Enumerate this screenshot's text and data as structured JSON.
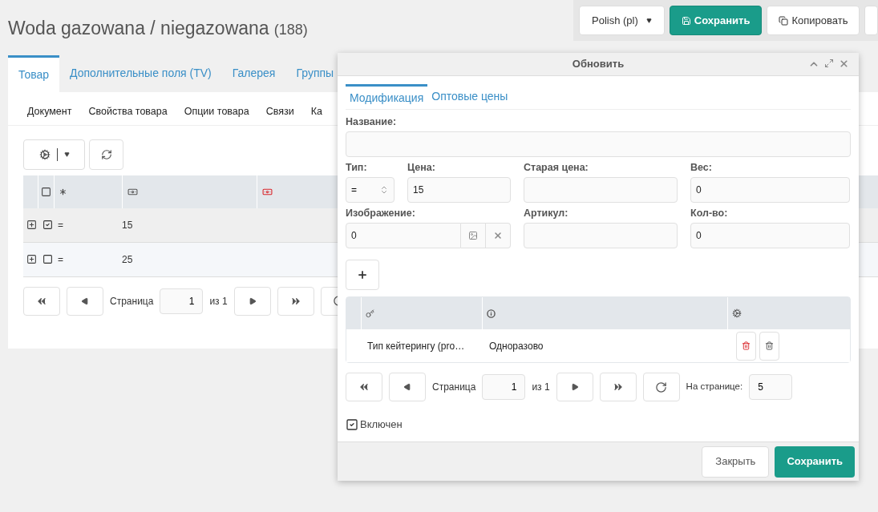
{
  "page": {
    "title": "Woda gazowana / niegazowana",
    "count": "(188)"
  },
  "toolbar": {
    "language": "Polish (pl)",
    "save": "Сохранить",
    "copy": "Копировать"
  },
  "tabs": [
    {
      "label": "Товар",
      "selected": true
    },
    {
      "label": "Дополнительные поля (TV)",
      "selected": false
    },
    {
      "label": "Галерея",
      "selected": false
    },
    {
      "label": "Группы",
      "selected": false
    }
  ],
  "subtabs": [
    "Документ",
    "Свойства товара",
    "Опции товара",
    "Связи",
    "Ка"
  ],
  "grid": {
    "all_checked": false,
    "rows": [
      {
        "checked": true,
        "type": "=",
        "price": "15"
      },
      {
        "checked": false,
        "type": "=",
        "price": "25"
      }
    ],
    "pager": {
      "page_label": "Страница",
      "page": "1",
      "of": "из 1"
    }
  },
  "dialog": {
    "title": "Обновить",
    "tabs": [
      {
        "label": "Модификация",
        "selected": true
      },
      {
        "label": "Оптовые цены",
        "selected": false
      }
    ],
    "name_label": "Название:",
    "type_label": "Тип:",
    "type_value": "=",
    "price_label": "Цена:",
    "price_value": "15",
    "old_price_label": "Старая цена:",
    "weight_label": "Вес:",
    "weight_value": "0",
    "image_label": "Изображение:",
    "image_value": "0",
    "article_label": "Артикул:",
    "qty_label": "Кол-во:",
    "qty_value": "0",
    "options": {
      "rows": [
        {
          "key": "Тип кейтерингу (pro…",
          "value": "Одноразово"
        }
      ],
      "pager": {
        "page_label": "Страница",
        "page": "1",
        "of": "из 1",
        "per_page_label": "На странице:",
        "per_page": "5"
      }
    },
    "enabled": {
      "label": "Включен",
      "checked": true
    },
    "close": "Закрыть",
    "save": "Сохранить"
  }
}
